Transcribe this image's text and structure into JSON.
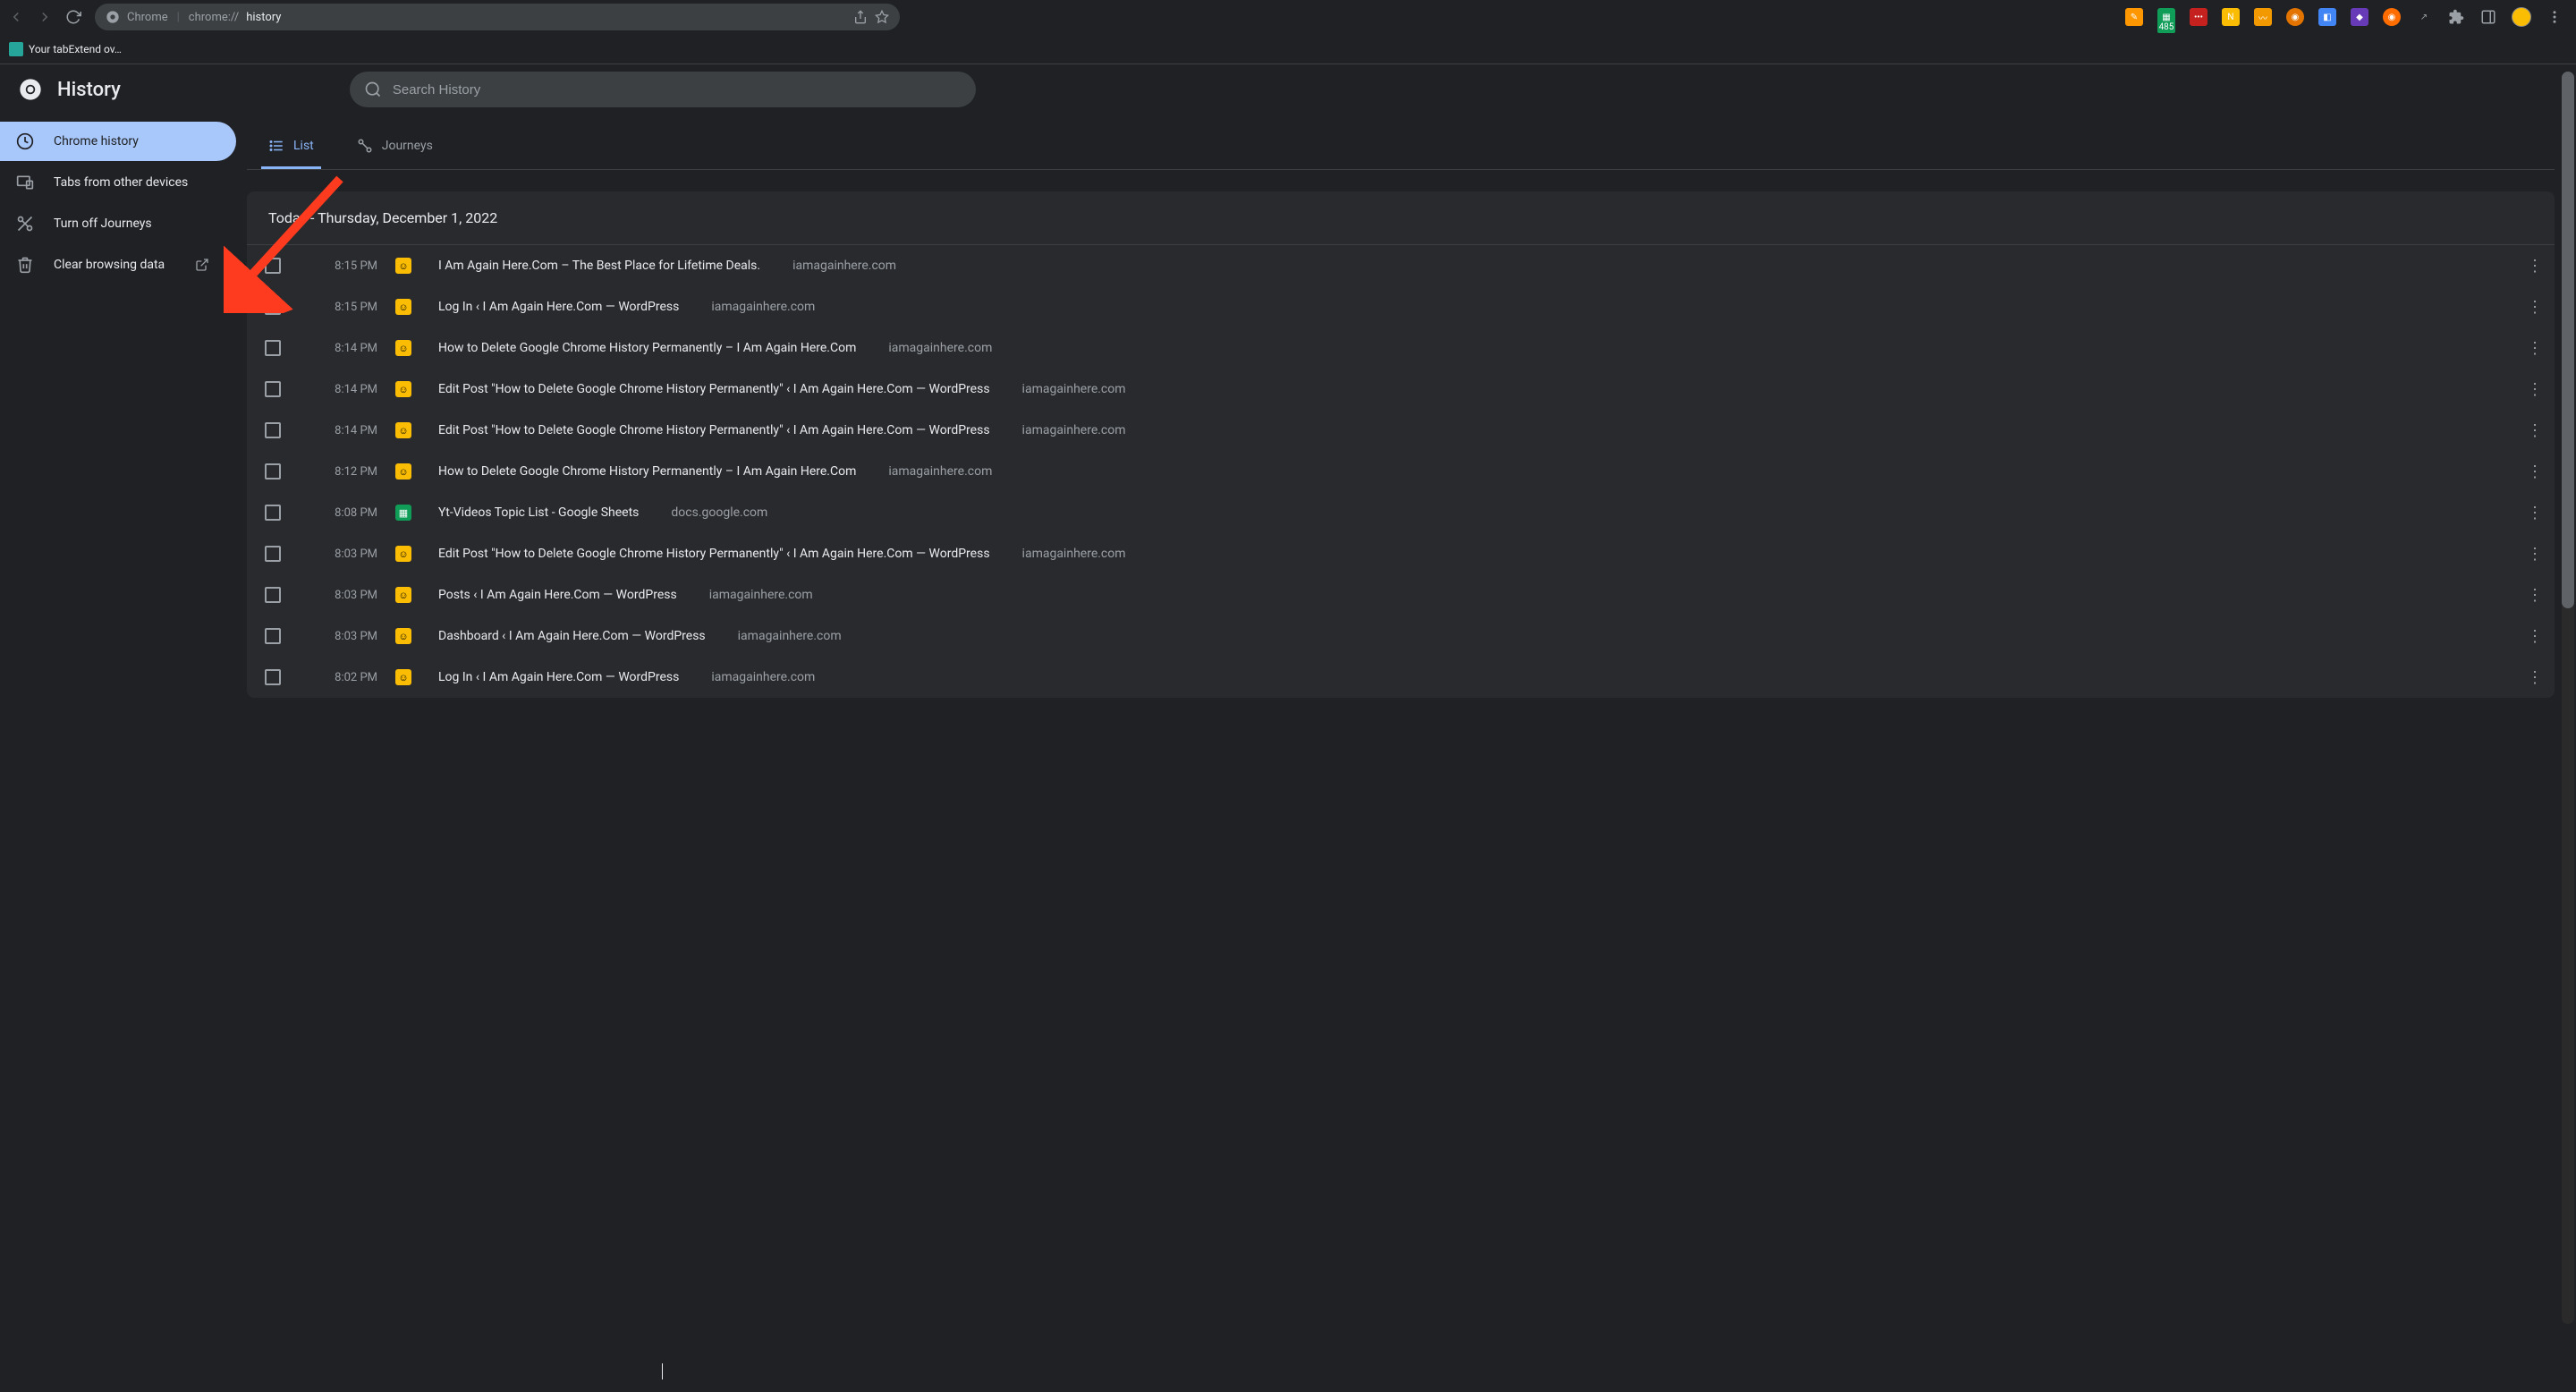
{
  "browser": {
    "omnibox_product": "Chrome",
    "omnibox_prefix": "chrome://",
    "omnibox_path": "history"
  },
  "bookmarks": {
    "item1": "Your tabExtend ov…"
  },
  "extensions": {
    "badge_485": "485"
  },
  "page": {
    "title": "History",
    "search_placeholder": "Search History"
  },
  "sidebar": {
    "items": [
      {
        "label": "Chrome history"
      },
      {
        "label": "Tabs from other devices"
      },
      {
        "label": "Turn off Journeys"
      },
      {
        "label": "Clear browsing data"
      }
    ]
  },
  "tabs": {
    "list": "List",
    "journeys": "Journeys"
  },
  "card": {
    "header": "Today - Thursday, December 1, 2022"
  },
  "entries": [
    {
      "time": "8:15 PM",
      "title": "I Am Again Here.Com – The Best Place for Lifetime Deals.",
      "domain": "iamagainhere.com",
      "fav": "yellow"
    },
    {
      "time": "8:15 PM",
      "title": "Log In ‹ I Am Again Here.Com — WordPress",
      "domain": "iamagainhere.com",
      "fav": "yellow"
    },
    {
      "time": "8:14 PM",
      "title": "How to Delete Google Chrome History Permanently – I Am Again Here.Com",
      "domain": "iamagainhere.com",
      "fav": "yellow"
    },
    {
      "time": "8:14 PM",
      "title": "Edit Post \"How to Delete Google Chrome History Permanently\" ‹ I Am Again Here.Com — WordPress",
      "domain": "iamagainhere.com",
      "fav": "yellow"
    },
    {
      "time": "8:14 PM",
      "title": "Edit Post \"How to Delete Google Chrome History Permanently\" ‹ I Am Again Here.Com — WordPress",
      "domain": "iamagainhere.com",
      "fav": "yellow"
    },
    {
      "time": "8:12 PM",
      "title": "How to Delete Google Chrome History Permanently – I Am Again Here.Com",
      "domain": "iamagainhere.com",
      "fav": "yellow"
    },
    {
      "time": "8:08 PM",
      "title": "Yt-Videos Topic List - Google Sheets",
      "domain": "docs.google.com",
      "fav": "green"
    },
    {
      "time": "8:03 PM",
      "title": "Edit Post \"How to Delete Google Chrome History Permanently\" ‹ I Am Again Here.Com — WordPress",
      "domain": "iamagainhere.com",
      "fav": "yellow"
    },
    {
      "time": "8:03 PM",
      "title": "Posts ‹ I Am Again Here.Com — WordPress",
      "domain": "iamagainhere.com",
      "fav": "yellow"
    },
    {
      "time": "8:03 PM",
      "title": "Dashboard ‹ I Am Again Here.Com — WordPress",
      "domain": "iamagainhere.com",
      "fav": "yellow"
    },
    {
      "time": "8:02 PM",
      "title": "Log In ‹ I Am Again Here.Com — WordPress",
      "domain": "iamagainhere.com",
      "fav": "yellow"
    }
  ]
}
